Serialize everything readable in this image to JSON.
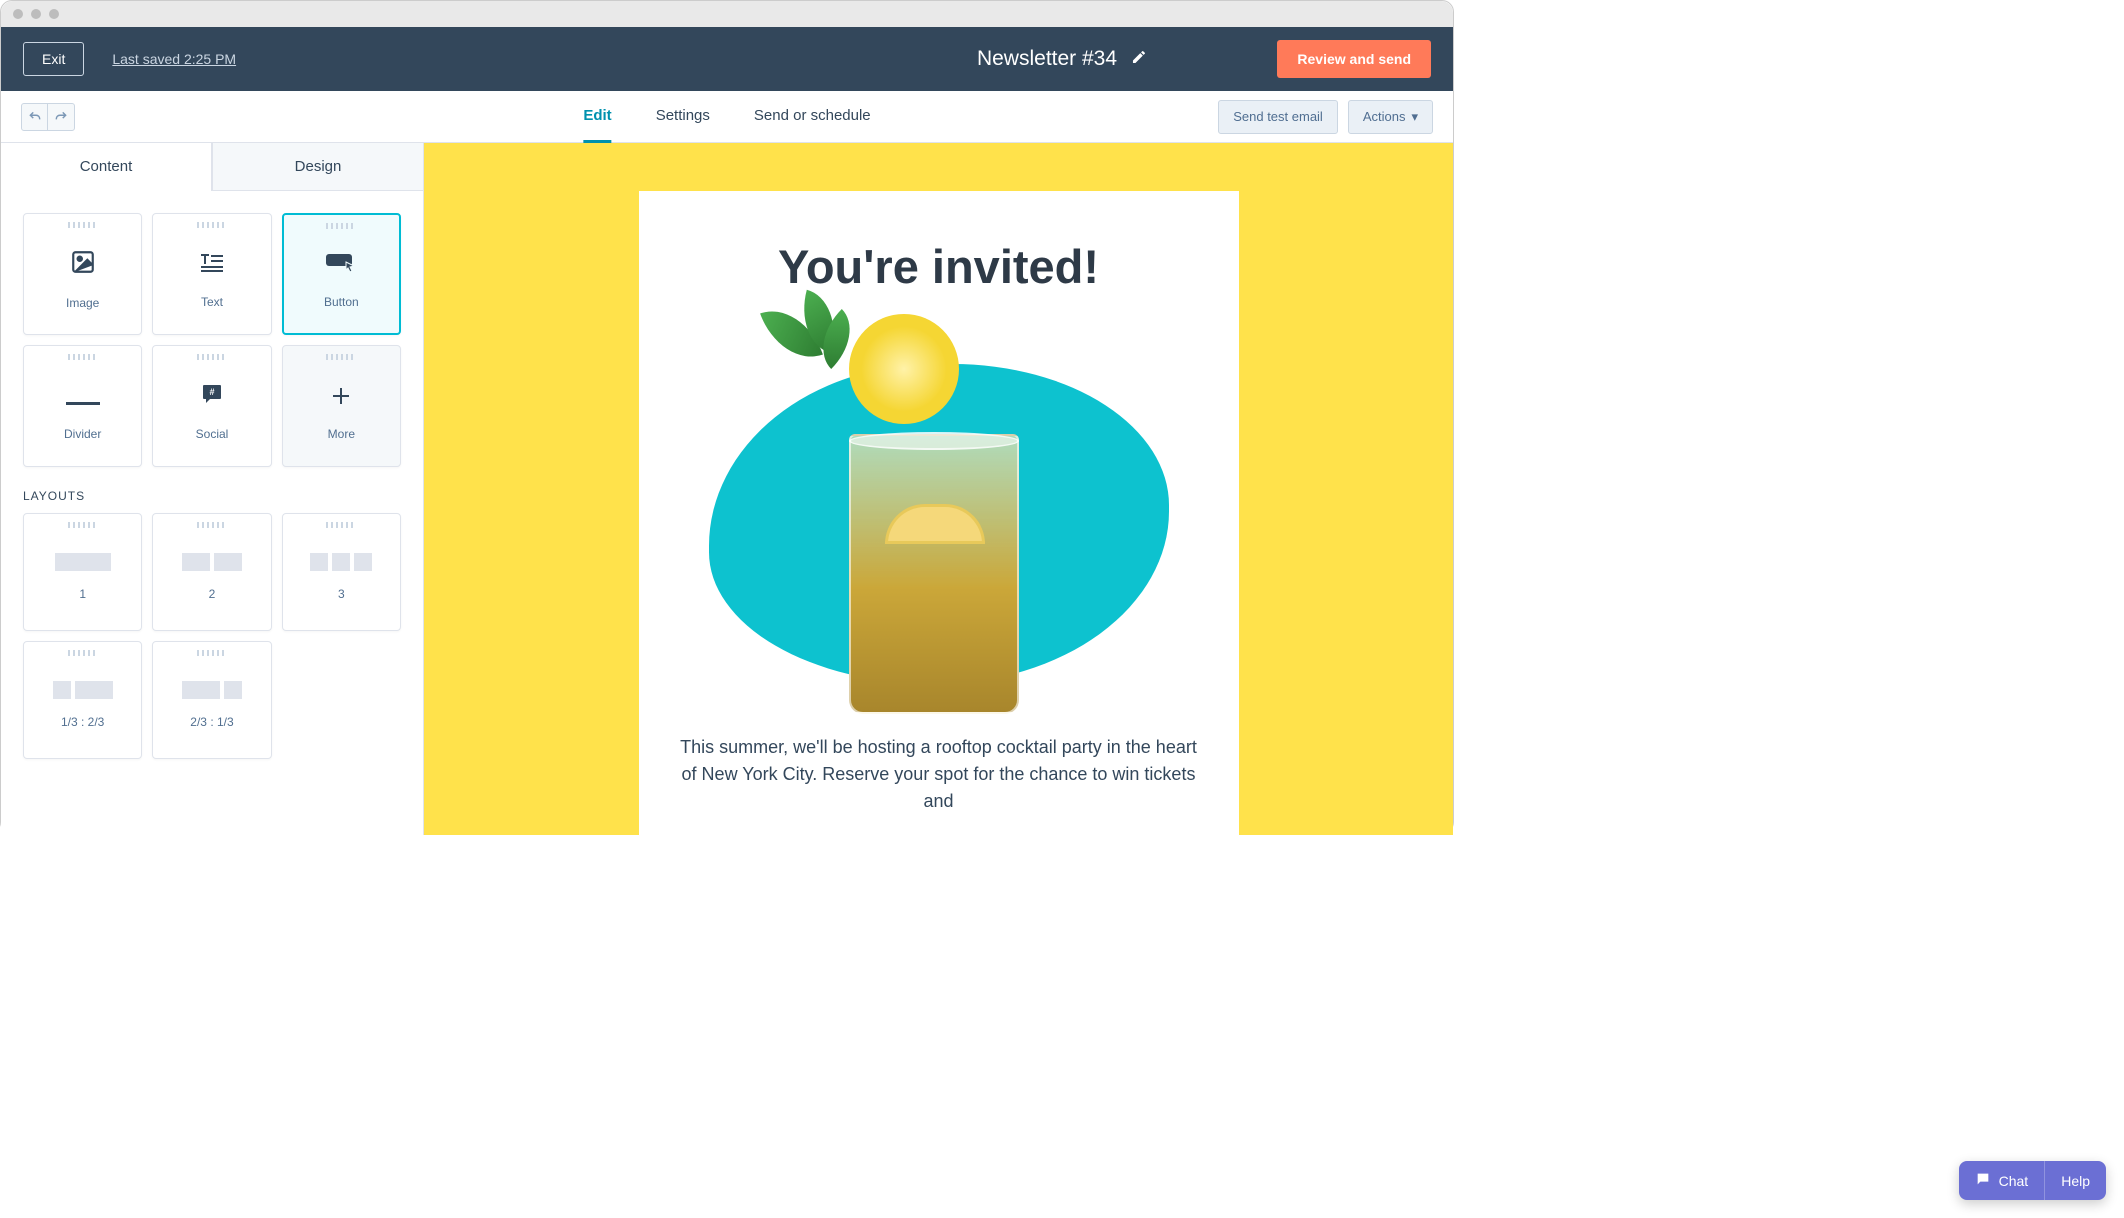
{
  "window": {
    "exit_label": "Exit",
    "last_saved": "Last saved 2:25 PM",
    "doc_title": "Newsletter #34",
    "review_label": "Review and send"
  },
  "nav_tabs": {
    "edit": "Edit",
    "settings": "Settings",
    "send": "Send or schedule"
  },
  "toolbar": {
    "send_test": "Send test email",
    "actions": "Actions"
  },
  "side_tabs": {
    "content": "Content",
    "design": "Design"
  },
  "blocks": {
    "image": "Image",
    "text": "Text",
    "button": "Button",
    "divider": "Divider",
    "social": "Social",
    "more": "More"
  },
  "layouts_section": "LAYOUTS",
  "layouts": {
    "l1": "1",
    "l2": "2",
    "l3": "3",
    "l13": "1/3 : 2/3",
    "l23": "2/3 : 1/3"
  },
  "email": {
    "headline": "You're invited!",
    "body": "This summer, we'll be hosting a rooftop cocktail party in the heart of New York City. Reserve your spot for the chance to win tickets and"
  },
  "chat_help": {
    "chat": "Chat",
    "help": "Help"
  },
  "colors": {
    "accent": "#ff7a59",
    "primary": "#33475b",
    "link": "#0091ae",
    "canvas_bg": "#ffe24b",
    "chat_bg": "#6b6fd4"
  }
}
